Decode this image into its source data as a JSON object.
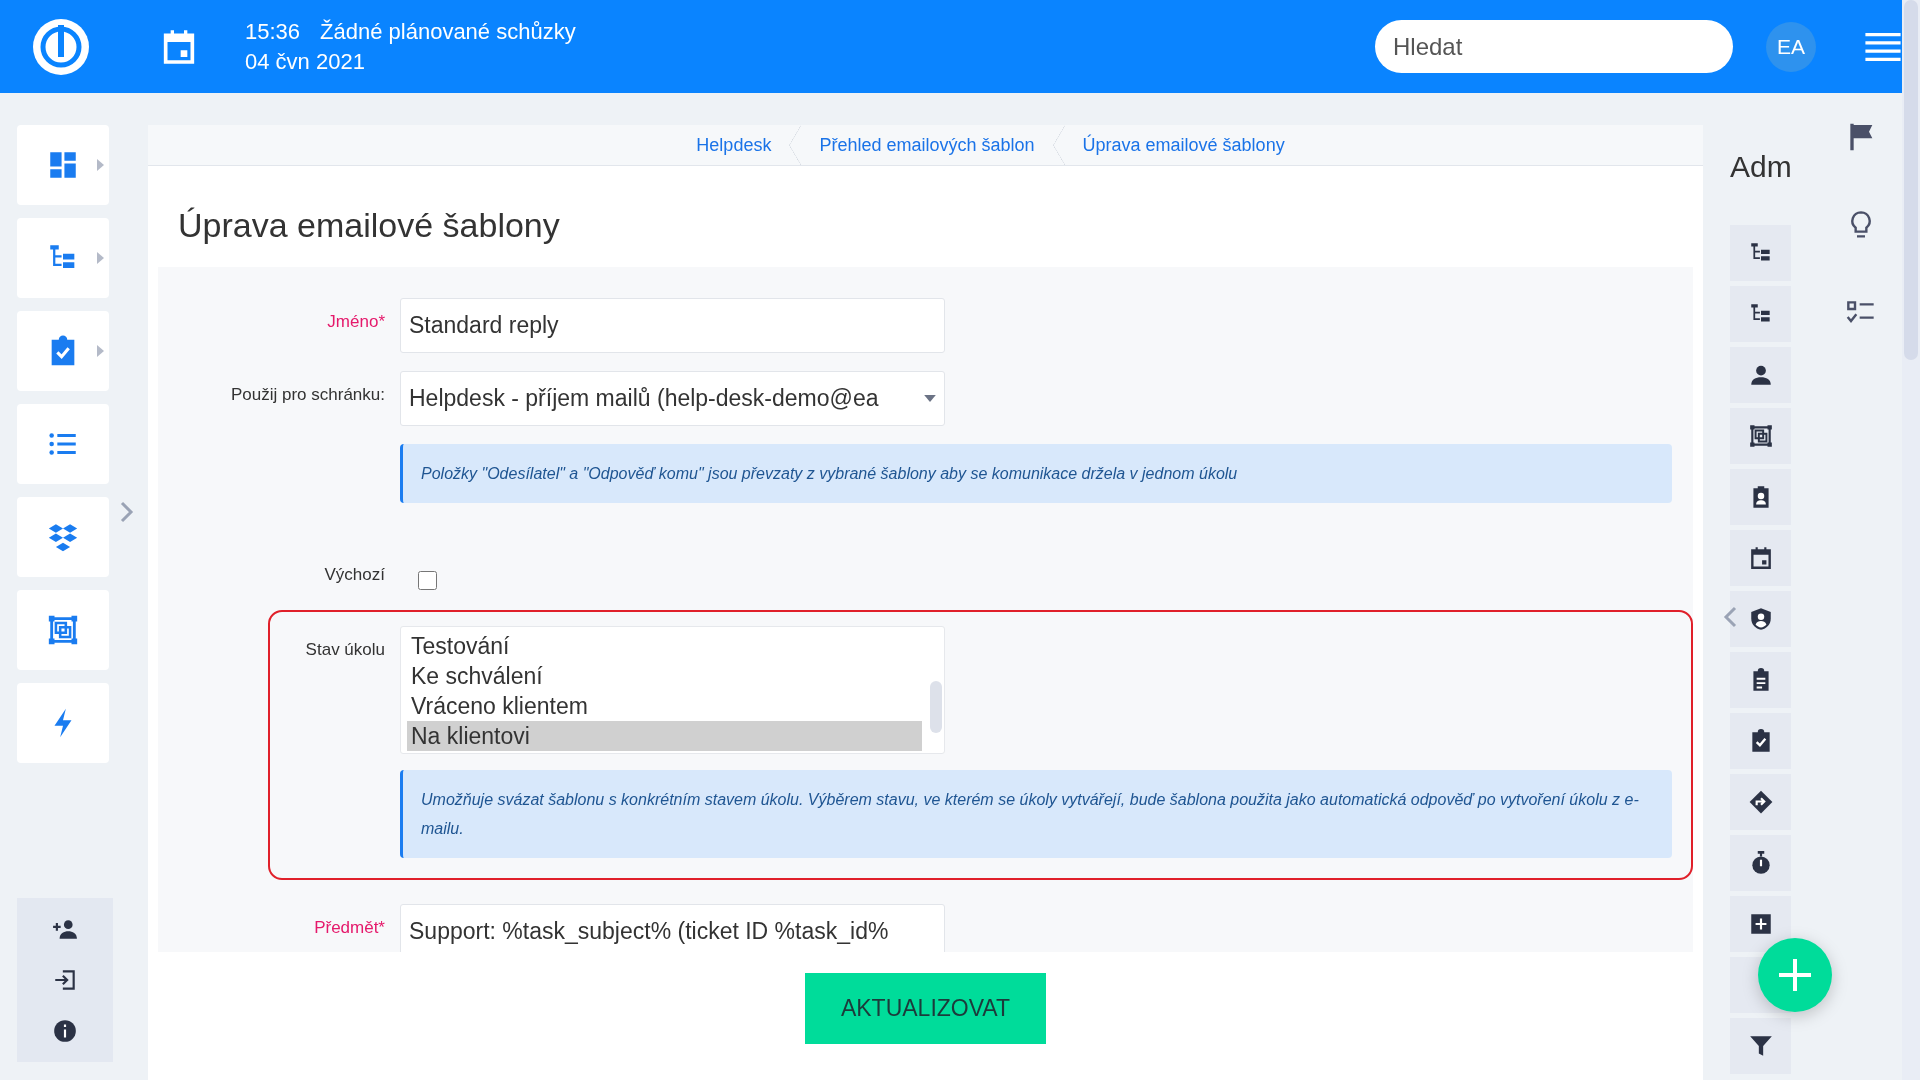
{
  "topbar": {
    "time": "15:36",
    "meetings": "Žádné plánované schůzky",
    "date": "04 čvn 2021",
    "search": {
      "placeholder": "Hledat"
    },
    "avatar": "EA"
  },
  "left_nav": {
    "items": [
      {
        "kind": "dashboard",
        "submenu": true
      },
      {
        "kind": "tree",
        "submenu": true
      },
      {
        "kind": "tasks",
        "submenu": true
      },
      {
        "kind": "list",
        "submenu": false
      },
      {
        "kind": "diamonds",
        "submenu": false
      },
      {
        "kind": "frame",
        "submenu": false
      },
      {
        "kind": "bolt",
        "submenu": false
      }
    ],
    "bottom": [
      {
        "kind": "adduser"
      },
      {
        "kind": "login"
      },
      {
        "kind": "info"
      }
    ]
  },
  "breadcrumbs": [
    "Helpdesk",
    "Přehled emailových šablon",
    "Úprava emailové šablony"
  ],
  "page_title": "Úprava emailové šablony",
  "form": {
    "fields": [
      {
        "kind": "text",
        "label": "Jméno*",
        "required": true,
        "value": "Standard reply"
      },
      {
        "kind": "select",
        "label": "Použij pro schránku:",
        "required": false,
        "value": "Helpdesk - příjem mailů (help-desk-demo@ea"
      },
      {
        "kind": "note",
        "text": "Položky \"Odesílatel\" a \"Odpověď komu\" jsou převzaty z vybrané šablony aby se komunikace držela v jednom úkolu"
      },
      {
        "kind": "checkbox",
        "label": "Výchozí",
        "checked": false
      },
      {
        "kind": "listbox",
        "label": "Stav úkolu",
        "highlighted": true,
        "options": [
          {
            "label": "Testování",
            "selected": false
          },
          {
            "label": "Ke schválení",
            "selected": false
          },
          {
            "label": "Vráceno klientem",
            "selected": false
          },
          {
            "label": "Na klientovi",
            "selected": true
          }
        ],
        "note": "Umožňuje svázat šablonu s konkrétním stavem úkolu. Výběrem stavu, ve kterém se úkoly vytvářejí, bude šablona použita jako automatická odpověď po vytvoření úkolu z e-mailu."
      },
      {
        "kind": "text",
        "label": "Předmět*",
        "required": true,
        "value": "Support: %task_subject% (ticket ID %task_id%"
      }
    ],
    "submit": "AKTUALIZOVAT"
  },
  "right_panel": {
    "title": "Adm",
    "items": [
      {
        "kind": "tree"
      },
      {
        "kind": "tree"
      },
      {
        "kind": "user"
      },
      {
        "kind": "frame"
      },
      {
        "kind": "badge"
      },
      {
        "kind": "calendar"
      },
      {
        "kind": "shield"
      },
      {
        "kind": "clipboard"
      },
      {
        "kind": "tasks"
      },
      {
        "kind": "direction"
      },
      {
        "kind": "timer"
      },
      {
        "kind": "plus"
      },
      {
        "kind": "blank"
      },
      {
        "kind": "filter"
      }
    ]
  },
  "far_right": [
    {
      "kind": "flag"
    },
    {
      "kind": "bulb"
    },
    {
      "kind": "checklist"
    }
  ]
}
